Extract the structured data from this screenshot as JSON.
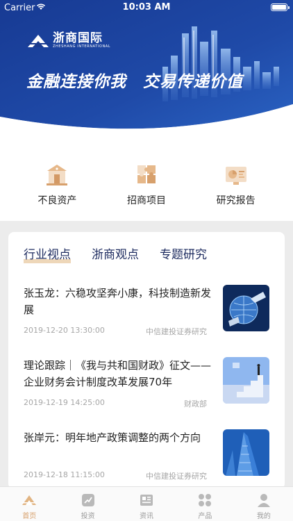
{
  "status_bar": {
    "carrier": "Carrier",
    "time": "10:03 AM"
  },
  "header": {
    "logo_cn": "浙商国际",
    "logo_en": "ZHESHANG INTERNATIONAL",
    "slogan": "金融连接你我　交易传递价值"
  },
  "quick_menu": [
    {
      "label": "不良资产",
      "icon": "bank-building-icon"
    },
    {
      "label": "招商项目",
      "icon": "puzzle-icon"
    },
    {
      "label": "研究报告",
      "icon": "report-chart-icon"
    }
  ],
  "tabs": [
    {
      "label": "行业视点",
      "active": true
    },
    {
      "label": "浙商观点",
      "active": false
    },
    {
      "label": "专题研究",
      "active": false
    }
  ],
  "news": [
    {
      "title": "张玉龙：六稳攻坚奔小康，科技制造新发展",
      "date": "2019-12-20 13:30:00",
      "source": "中信建投证券研究",
      "thumb": "globe-hands-image"
    },
    {
      "title": "理论跟踪｜《我与共和国财政》征文—— 企业财务会计制度改革发展70年",
      "date": "2019-12-19 14:25:00",
      "source": "财政部",
      "thumb": "stairs-man-image"
    },
    {
      "title": "张岸元：明年地产政策调整的两个方向",
      "date": "2019-12-18 11:15:00",
      "source": "中信建投证券研究",
      "thumb": "skyscraper-image"
    }
  ],
  "tabbar": [
    {
      "label": "首页",
      "icon": "home-icon",
      "active": true
    },
    {
      "label": "投资",
      "icon": "invest-icon",
      "active": false
    },
    {
      "label": "资讯",
      "icon": "news-icon",
      "active": false
    },
    {
      "label": "产品",
      "icon": "grid-icon",
      "active": false
    },
    {
      "label": "我的",
      "icon": "user-icon",
      "active": false
    }
  ],
  "colors": {
    "header_blue": "#1a3b8f",
    "accent_gold": "#d7a06c",
    "tab_text": "#1e2c60"
  }
}
